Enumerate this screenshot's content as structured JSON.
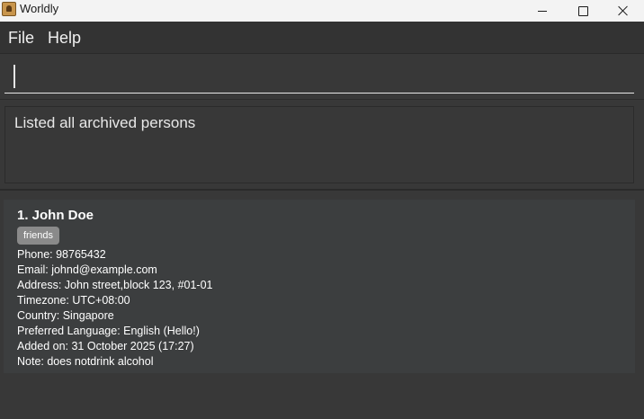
{
  "window": {
    "title": "Worldly"
  },
  "menu": {
    "file": "File",
    "help": "Help"
  },
  "command": {
    "value": ""
  },
  "result": {
    "message": "Listed all archived persons"
  },
  "persons": [
    {
      "index_name": "1. John Doe",
      "tags": [
        "friends"
      ],
      "phone": "Phone: 98765432",
      "email": "Email: johnd@example.com",
      "address": "Address: John street,block 123, #01-01",
      "timezone": "Timezone: UTC+08:00",
      "country": "Country: Singapore",
      "language": "Preferred Language: English (Hello!)",
      "added_on": "Added on: 31 October 2025 (17:27)",
      "note": "Note: does notdrink alcohol"
    }
  ],
  "colors": {
    "background": "#383838",
    "card": "#3c3e3f",
    "tag": "#8a8a8a",
    "titlebar": "#f3f3f3"
  }
}
